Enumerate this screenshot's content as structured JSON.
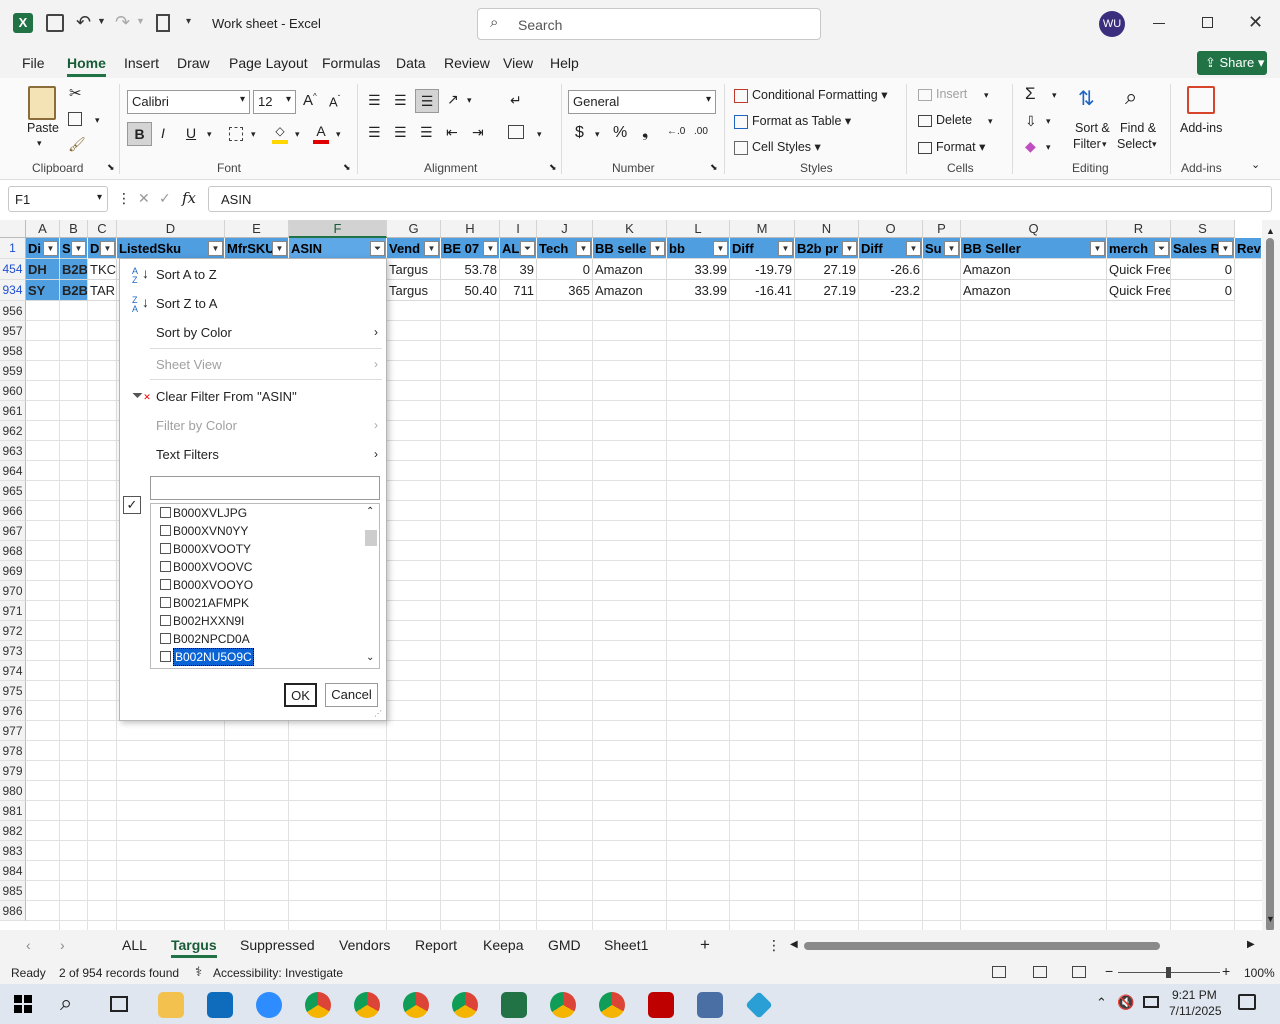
{
  "title_bar": {
    "doc_title": "Work sheet  -  Excel",
    "search_placeholder": "Search",
    "user_initials": "WU"
  },
  "menu": {
    "file": "File",
    "home": "Home",
    "insert": "Insert",
    "draw": "Draw",
    "page_layout": "Page Layout",
    "formulas": "Formulas",
    "data": "Data",
    "review": "Review",
    "view": "View",
    "help": "Help",
    "share": "Share"
  },
  "ribbon": {
    "paste": "Paste",
    "clipboard": "Clipboard",
    "font_name": "Calibri",
    "font_size": "12",
    "font": "Font",
    "alignment": "Alignment",
    "number_format": "General",
    "number": "Number",
    "conditional_formatting": "Conditional Formatting",
    "format_as_table": "Format as Table",
    "cell_styles": "Cell Styles",
    "styles": "Styles",
    "insert": "Insert",
    "delete": "Delete",
    "format": "Format",
    "cells": "Cells",
    "sort_filter_1": "Sort &",
    "sort_filter_2": "Filter",
    "find_select_1": "Find &",
    "find_select_2": "Select",
    "editing": "Editing",
    "addins_btn": "Add-ins",
    "addins": "Add-ins"
  },
  "formula_bar": {
    "name_box": "F1",
    "formula": "ASIN"
  },
  "columns": [
    "A",
    "B",
    "C",
    "D",
    "E",
    "F",
    "G",
    "H",
    "I",
    "J",
    "K",
    "L",
    "M",
    "N",
    "O",
    "P",
    "Q",
    "R",
    "S"
  ],
  "header_row": {
    "row_num": "1",
    "cells": [
      "Di",
      "S",
      "D",
      "ListedSku",
      "MfrSKU",
      "ASIN",
      "Vend",
      "BE 07",
      "ALL",
      "Tech",
      "BB selle",
      "bb",
      "Diff",
      "B2b pr",
      "Diff",
      "Su",
      "BB Seller",
      "merch",
      "Sales R",
      "Rev"
    ]
  },
  "data_rows": [
    {
      "num": "454",
      "cells": [
        "DH",
        "B2B",
        "TKC",
        "",
        "",
        "",
        "Targus",
        "53.78",
        "39",
        "0",
        "Amazon",
        "33.99",
        "-19.79",
        "27.19",
        "-26.6",
        "",
        "Amazon",
        "Quick Free",
        "0"
      ]
    },
    {
      "num": "934",
      "cells": [
        "SY",
        "B2B",
        "TAR",
        "",
        "",
        "",
        "Targus",
        "50.40",
        "711",
        "365",
        "Amazon",
        "33.99",
        "-16.41",
        "27.19",
        "-23.2",
        "",
        "Amazon",
        "Quick Free",
        "0"
      ]
    }
  ],
  "row_numbers": [
    "956",
    "957",
    "958",
    "959",
    "960",
    "961",
    "962",
    "963",
    "964",
    "965",
    "966",
    "967",
    "968",
    "969",
    "970",
    "971",
    "972",
    "973",
    "974",
    "975",
    "976",
    "977",
    "978",
    "979",
    "980",
    "981",
    "982",
    "983",
    "984",
    "985",
    "986"
  ],
  "dropdown": {
    "sort_az": "Sort A to Z",
    "sort_za": "Sort Z to A",
    "sort_by_color": "Sort by Color",
    "sheet_view": "Sheet View",
    "clear_filter": "Clear Filter From \"ASIN\"",
    "filter_by_color": "Filter by Color",
    "text_filters": "Text Filters",
    "search_value": "",
    "items": [
      "B000XVLJPG",
      "B000XVN0YY",
      "B000XVOOTY",
      "B000XVOOVC",
      "B000XVOOYO",
      "B0021AFMPK",
      "B002HXXN9I",
      "B002NPCD0A",
      "B002NU5O9C"
    ],
    "ok": "OK",
    "cancel": "Cancel"
  },
  "sheet_tabs": [
    "ALL",
    "Targus",
    "Suppressed",
    "Vendors",
    "Report",
    "Keepa",
    "GMD",
    "Sheet1"
  ],
  "status": {
    "ready": "Ready",
    "records": "2 of 954 records found",
    "accessibility": "Accessibility: Investigate",
    "zoom": "100%"
  },
  "taskbar": {
    "time": "9:21 PM",
    "date": "7/11/2025"
  },
  "colors": {
    "excel_green": "#217346",
    "header_fill": "#4f9ee0",
    "selected_item": "#0a64d6"
  }
}
